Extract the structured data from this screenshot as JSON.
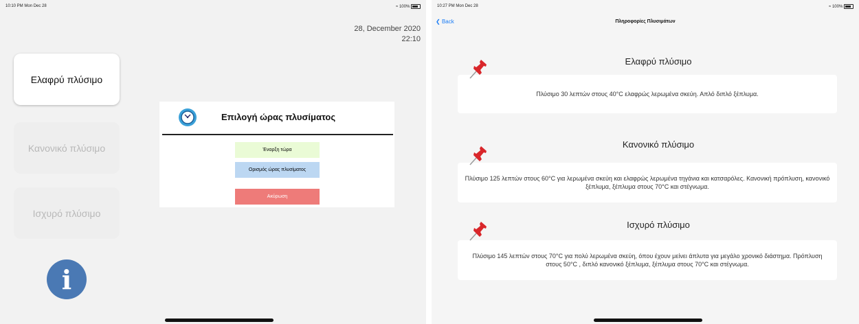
{
  "left_screen": {
    "status": {
      "time": "10:10 PM",
      "date": "Mon Dec 28",
      "battery": "100%"
    },
    "datetime": {
      "date": "28, December 2020",
      "time": "22:10"
    },
    "wash_buttons": [
      {
        "label": "Ελαφρύ πλύσιμο",
        "state": "active"
      },
      {
        "label": "Κανονικό πλύσιμο",
        "state": "inactive"
      },
      {
        "label": "Ισχυρό πλύσιμο",
        "state": "inactive"
      }
    ],
    "info_icon_glyph": "i",
    "dialog": {
      "title": "Επιλογή ώρας πλυσίματος",
      "start_now": "Έναρξη τώρα",
      "set_time": "Ορισμός ώρας πλυσίματος",
      "cancel": "Ακύρωση"
    }
  },
  "right_screen": {
    "status": {
      "time": "10:27 PM",
      "date": "Mon Dec 28",
      "battery": "100%"
    },
    "nav": {
      "back": "Back",
      "title": "Πληροφορίες Πλυσιμάτων"
    },
    "sections": [
      {
        "title": "Ελαφρύ πλύσιμο",
        "text": "Πλύσιμο 30 λεπτών στους 40°C ελαφρώς λερωμένα σκεύη. Απλό διπλό ξέπλυμα."
      },
      {
        "title": "Κανονικό πλύσιμο",
        "text": "Πλύσιμο 125 λεπτών στους 60°C για λερωμένα σκεύη και ελαφρώς λερωμένα τηγάνια και κατσαρόλες. Κανονική πρόπλυση, κανονικό ξέπλυμα, ξέπλυμα στους 70°C και στέγνωμα."
      },
      {
        "title": "Ισχυρό πλύσιμο",
        "text": "Πλύσιμο 145 λεπτών στους 70°C για πολύ λερωμένα σκεύη, όπου έχουν μείνει άπλυτα για μεγάλο χρονικό διάστημα. Πρόπλυση στους 50°C , διπλό κανονικό ξέπλυμα, ξέπλυμα στους 70°C και στέγνωμα."
      }
    ]
  },
  "colors": {
    "start_now_bg": "#eafbd6",
    "set_time_bg": "#bcd7f2",
    "cancel_bg": "#ee7b79",
    "info_button": "#4a79b4",
    "accent_blue": "#1a7cf5",
    "pin_red": "#d9262a"
  },
  "icons": [
    "clock-icon",
    "info-icon",
    "pushpin-icon",
    "back-chevron-icon",
    "wifi-icon",
    "battery-icon"
  ]
}
